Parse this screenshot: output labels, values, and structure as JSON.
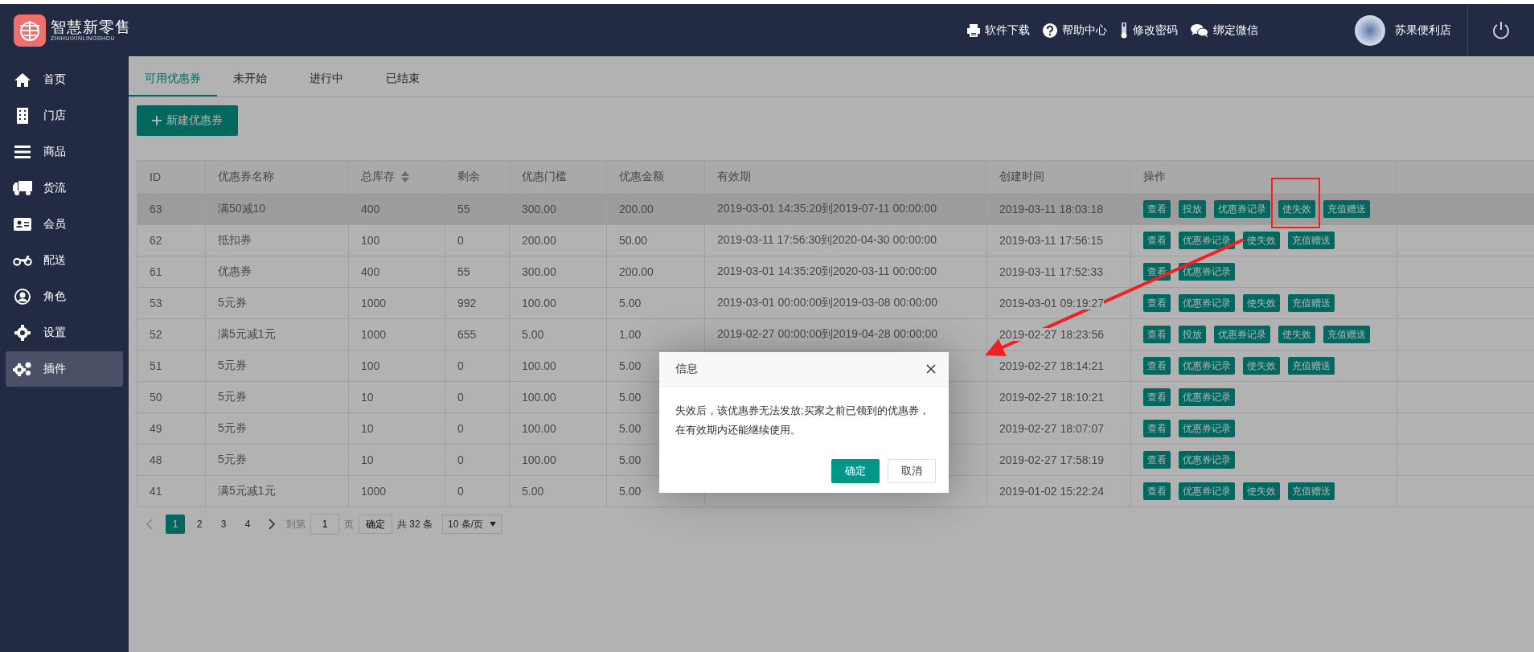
{
  "header": {
    "logo_title": "智慧新零售",
    "logo_subtitle": "ZHIHUIXINLINGSHOU",
    "links": [
      {
        "label": "软件下载"
      },
      {
        "label": "帮助中心"
      },
      {
        "label": "修改密码"
      },
      {
        "label": "绑定微信"
      }
    ],
    "user": "苏果便利店"
  },
  "sidebar": {
    "items": [
      {
        "label": "首页",
        "selected": false
      },
      {
        "label": "门店",
        "selected": false
      },
      {
        "label": "商品",
        "selected": false
      },
      {
        "label": "货流",
        "selected": false
      },
      {
        "label": "会员",
        "selected": false
      },
      {
        "label": "配送",
        "selected": false
      },
      {
        "label": "角色",
        "selected": false
      },
      {
        "label": "设置",
        "selected": false
      },
      {
        "label": "插件",
        "selected": true
      }
    ]
  },
  "tabs": [
    {
      "label": "可用优惠券",
      "selected": true
    },
    {
      "label": "未开始",
      "selected": false
    },
    {
      "label": "进行中",
      "selected": false
    },
    {
      "label": "已结束",
      "selected": false
    }
  ],
  "new_button": "新建优惠券",
  "table": {
    "columns": [
      {
        "label": "ID",
        "sortable": false
      },
      {
        "label": "优惠券名称",
        "sortable": false
      },
      {
        "label": "总库存",
        "sortable": true
      },
      {
        "label": "剩余",
        "sortable": false
      },
      {
        "label": "优惠门槛",
        "sortable": false
      },
      {
        "label": "优惠金额",
        "sortable": false
      },
      {
        "label": "有效期",
        "sortable": false
      },
      {
        "label": "创建时间",
        "sortable": false
      },
      {
        "label": "操作",
        "sortable": false
      }
    ],
    "rows": [
      {
        "hovered": true,
        "cells": [
          "63",
          "满50减10",
          "400",
          "55",
          "300.00",
          "200.00",
          "2019-03-01 14:35:20到2019-07-11 00:00:00",
          "2019-03-11 18:03:18"
        ],
        "actions": [
          "查看",
          "投放",
          "优惠券记录",
          "使失效",
          "充值赠送"
        ]
      },
      {
        "hovered": false,
        "cells": [
          "62",
          "抵扣券",
          "100",
          "0",
          "200.00",
          "50.00",
          "2019-03-11 17:56:30到2020-04-30 00:00:00",
          "2019-03-11 17:56:15"
        ],
        "actions": [
          "查看",
          "优惠券记录",
          "使失效",
          "充值赠送"
        ]
      },
      {
        "hovered": false,
        "cells": [
          "61",
          "优惠券",
          "400",
          "55",
          "300.00",
          "200.00",
          "2019-03-01 14:35:20到2020-03-11 00:00:00",
          "2019-03-11 17:52:33"
        ],
        "actions": [
          "查看",
          "优惠券记录"
        ]
      },
      {
        "hovered": false,
        "cells": [
          "53",
          "5元券",
          "1000",
          "992",
          "100.00",
          "5.00",
          "2019-03-01 00:00:00到2019-03-08 00:00:00",
          "2019-03-01 09:19:27"
        ],
        "actions": [
          "查看",
          "优惠券记录",
          "使失效",
          "充值赠送"
        ]
      },
      {
        "hovered": false,
        "cells": [
          "52",
          "满5元减1元",
          "1000",
          "655",
          "5.00",
          "1.00",
          "2019-02-27 00:00:00到2019-04-28 00:00:00",
          "2019-02-27 18:23:56"
        ],
        "actions": [
          "查看",
          "投放",
          "优惠券记录",
          "使失效",
          "充值赠送"
        ]
      },
      {
        "hovered": false,
        "cells": [
          "51",
          "5元券",
          "100",
          "0",
          "100.00",
          "5.00",
          null,
          "2019-02-27 18:14:21"
        ],
        "actions": [
          "查看",
          "优惠券记录",
          "使失效",
          "充值赠送"
        ]
      },
      {
        "hovered": false,
        "cells": [
          "50",
          "5元券",
          "10",
          "0",
          "100.00",
          "5.00",
          null,
          "2019-02-27 18:10:21"
        ],
        "actions": [
          "查看",
          "优惠券记录"
        ]
      },
      {
        "hovered": false,
        "cells": [
          "49",
          "5元券",
          "10",
          "0",
          "100.00",
          "5.00",
          null,
          "2019-02-27 18:07:07"
        ],
        "actions": [
          "查看",
          "优惠券记录"
        ]
      },
      {
        "hovered": false,
        "cells": [
          "48",
          "5元券",
          "10",
          "0",
          "100.00",
          "5.00",
          null,
          "2019-02-27 17:58:19"
        ],
        "actions": [
          "查看",
          "优惠券记录"
        ]
      },
      {
        "hovered": false,
        "cells": [
          "41",
          "满5元减1元",
          "1000",
          "0",
          "5.00",
          "5.00",
          null,
          "2019-01-02 15:22:24"
        ],
        "actions": [
          "查看",
          "优惠券记录",
          "使失效",
          "充值赠送"
        ]
      }
    ]
  },
  "pagination": {
    "pages": [
      {
        "label": "1",
        "selected": true
      },
      {
        "label": "2",
        "selected": false
      },
      {
        "label": "3",
        "selected": false
      },
      {
        "label": "4",
        "selected": false
      }
    ],
    "goto_label": "到第",
    "goto_value": "1",
    "page_label": "页",
    "confirm": "确定",
    "total": "共 32 条",
    "page_size": "10 条/页"
  },
  "dialog": {
    "title": "信息",
    "message": "失效后，该优惠券无法发放;买家之前已领到的优惠券，在有效期内还能继续使用。",
    "buttons": [
      {
        "label": "确定",
        "kind": "primary"
      },
      {
        "label": "取消",
        "kind": "secondary"
      }
    ]
  }
}
